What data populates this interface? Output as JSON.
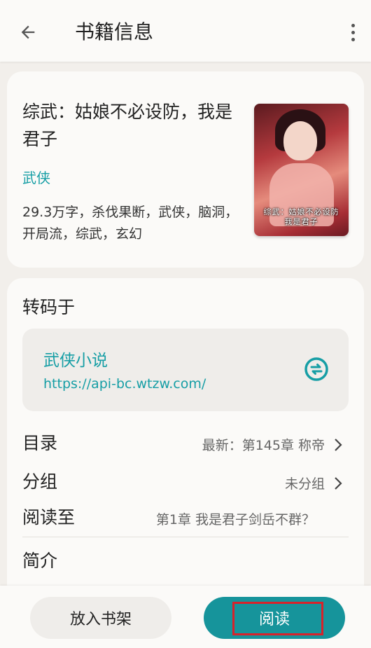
{
  "header": {
    "title": "书籍信息"
  },
  "book": {
    "title": "综武：姑娘不必设防，我是君子",
    "category": "武侠",
    "tags": "29.3万字，杀伐果断，武侠，脑洞，开局流，综武，玄幻",
    "cover_text": "综武：姑娘不必设防\n我是君子"
  },
  "source": {
    "section_title": "转码于",
    "name": "武侠小说",
    "url": "https://api-bc.wtzw.com/"
  },
  "rows": {
    "toc_label": "目录",
    "toc_value": "最新：第145章 称帝",
    "group_label": "分组",
    "group_value": "未分组",
    "read_label": "阅读至",
    "read_value": "第1章 我是君子剑岳不群？",
    "intro_label": "简介"
  },
  "actions": {
    "shelf_label": "放入书架",
    "read_label": "阅读"
  },
  "colors": {
    "accent": "#169ea5",
    "read_button": "#16949b",
    "highlight": "#d8222a"
  },
  "icons": {
    "back": "arrow-left-icon",
    "more": "more-vertical-icon",
    "switch": "swap-icon",
    "chevron": "chevron-right-icon"
  }
}
